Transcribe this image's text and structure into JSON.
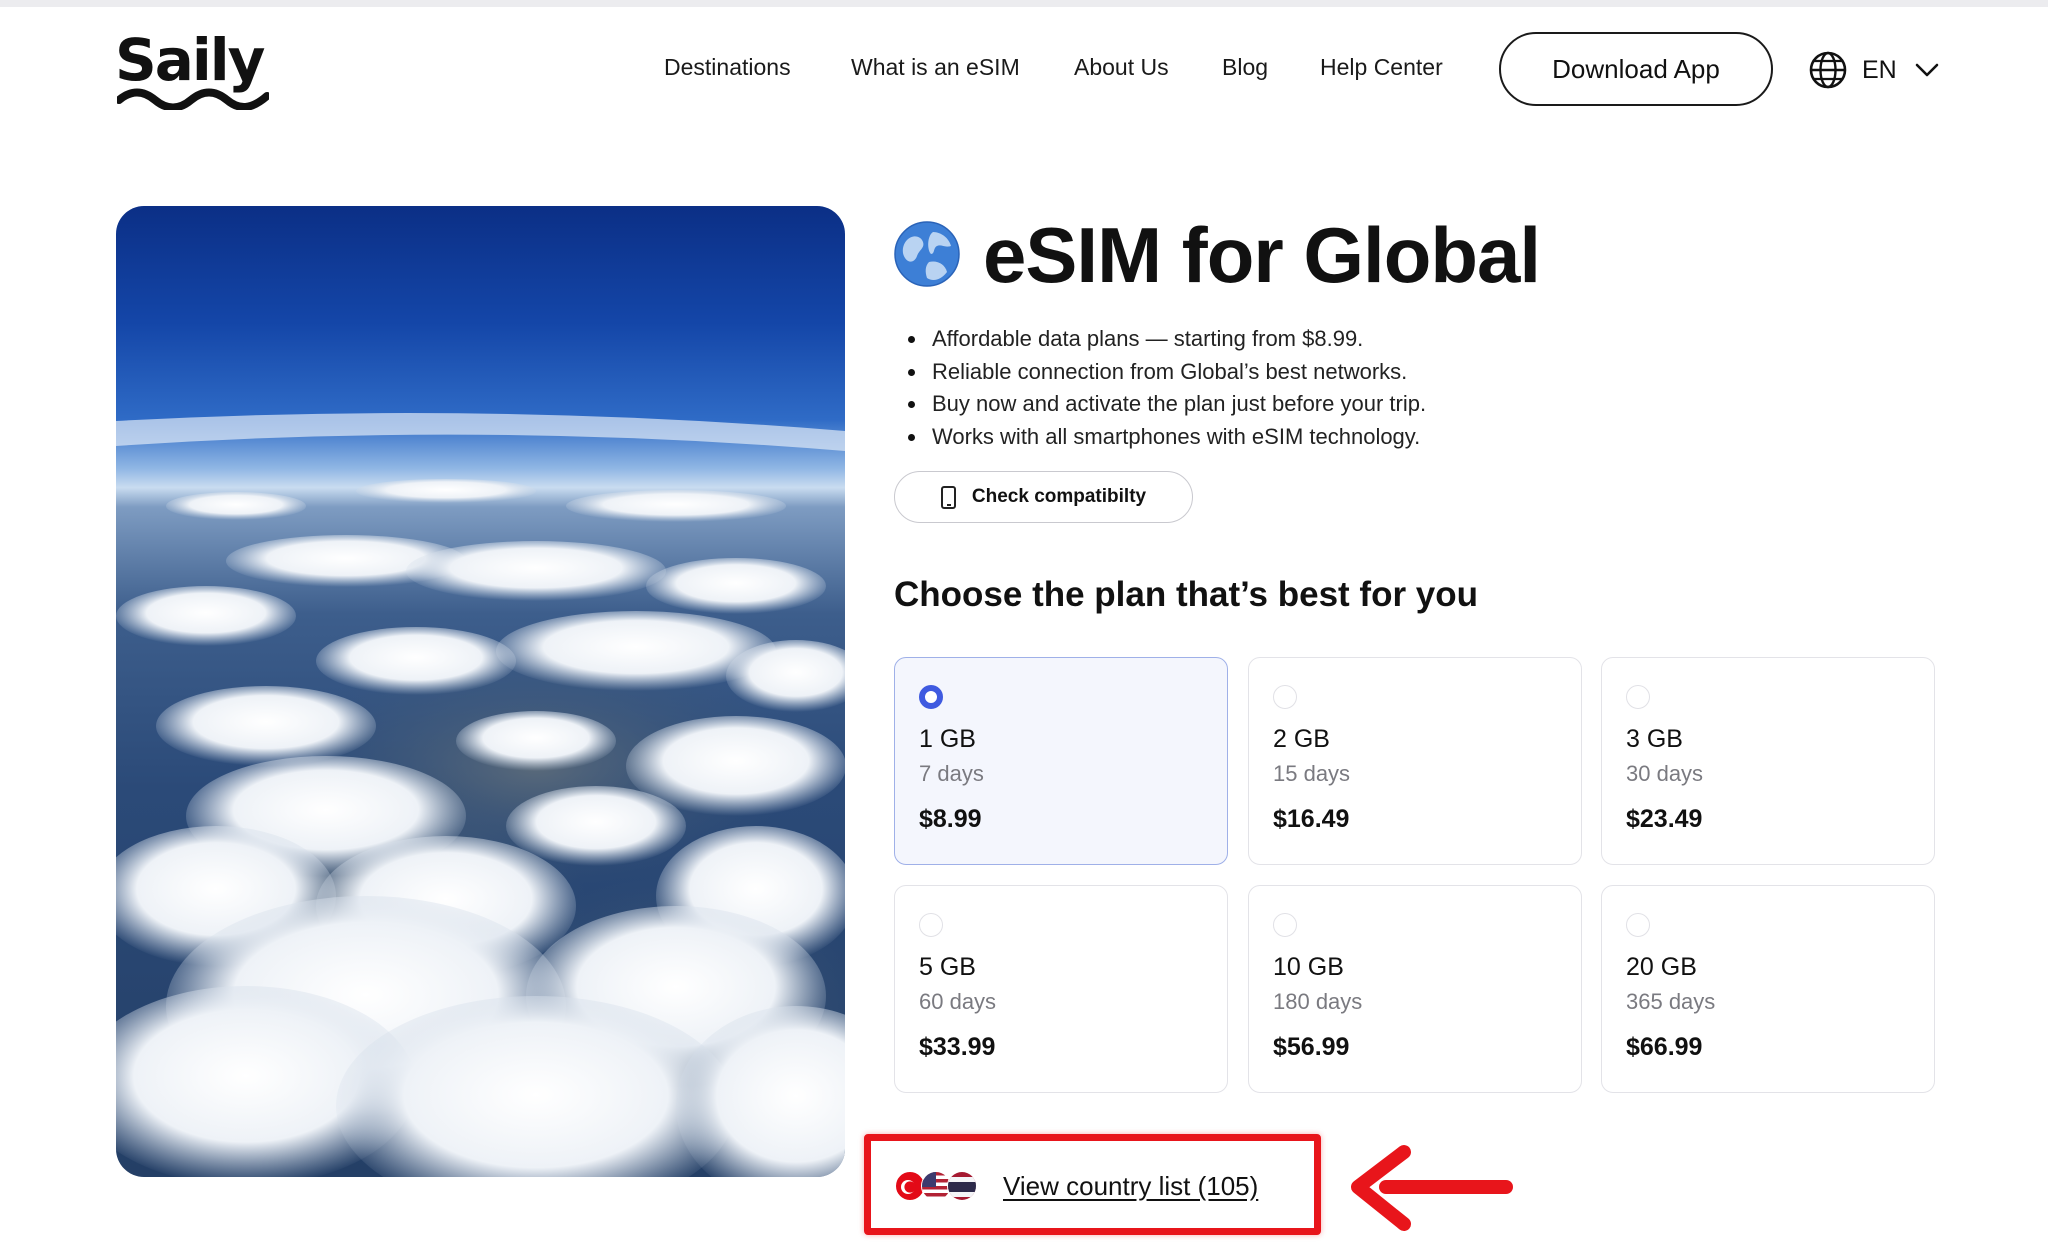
{
  "brand": {
    "logo_text": "Saily"
  },
  "nav": {
    "items": [
      {
        "label": "Destinations"
      },
      {
        "label": "What is an eSIM"
      },
      {
        "label": "About Us"
      },
      {
        "label": "Blog"
      },
      {
        "label": "Help Center"
      }
    ],
    "download_label": "Download App",
    "language": "EN"
  },
  "product": {
    "title": "eSIM for Global",
    "bullets": [
      "Affordable data plans — starting from $8.99.",
      "Reliable connection from Global’s best networks.",
      "Buy now and activate the plan just before your trip.",
      "Works with all smartphones with eSIM technology."
    ],
    "compat_label": "Check compatibilty"
  },
  "plans": {
    "heading": "Choose the plan that’s best for you",
    "selected_index": 0,
    "items": [
      {
        "size": "1 GB",
        "days": "7 days",
        "price": "$8.99"
      },
      {
        "size": "2 GB",
        "days": "15 days",
        "price": "$16.49"
      },
      {
        "size": "3 GB",
        "days": "30 days",
        "price": "$23.49"
      },
      {
        "size": "5 GB",
        "days": "60 days",
        "price": "$33.99"
      },
      {
        "size": "10 GB",
        "days": "180 days",
        "price": "$56.99"
      },
      {
        "size": "20 GB",
        "days": "365 days",
        "price": "$66.99"
      }
    ]
  },
  "country_list": {
    "label": "View country list (105)"
  },
  "colors": {
    "accent_radio": "#3f5ae0",
    "selected_card_bg": "#f4f6fd",
    "annotation_red": "#e8151b"
  },
  "icons": {
    "globe": "globe-icon",
    "chevron": "chevron-down-icon",
    "phone": "phone-icon",
    "title_emoji": "earth-globe-icon"
  }
}
